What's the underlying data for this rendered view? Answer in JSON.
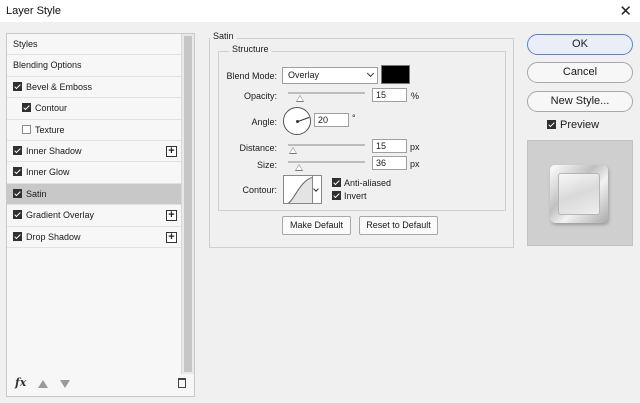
{
  "window": {
    "title": "Layer Style",
    "close_glyph": "✕"
  },
  "styles_panel": {
    "items": [
      {
        "label": "Styles",
        "checkbox": "none",
        "indent": false,
        "plus": false,
        "selected": false
      },
      {
        "label": "Blending Options",
        "checkbox": "none",
        "indent": false,
        "plus": false,
        "selected": false
      },
      {
        "label": "Bevel & Emboss",
        "checkbox": "on",
        "indent": false,
        "plus": false,
        "selected": false
      },
      {
        "label": "Contour",
        "checkbox": "on",
        "indent": true,
        "plus": false,
        "selected": false
      },
      {
        "label": "Texture",
        "checkbox": "off",
        "indent": true,
        "plus": false,
        "selected": false
      },
      {
        "label": "Inner Shadow",
        "checkbox": "on",
        "indent": false,
        "plus": true,
        "selected": false
      },
      {
        "label": "Inner Glow",
        "checkbox": "on",
        "indent": false,
        "plus": false,
        "selected": false
      },
      {
        "label": "Satin",
        "checkbox": "on",
        "indent": false,
        "plus": false,
        "selected": true
      },
      {
        "label": "Gradient Overlay",
        "checkbox": "on",
        "indent": false,
        "plus": true,
        "selected": false
      },
      {
        "label": "Drop Shadow",
        "checkbox": "on",
        "indent": false,
        "plus": true,
        "selected": false
      }
    ],
    "fx_label": "fx"
  },
  "satin": {
    "group_title": "Satin",
    "structure_title": "Structure",
    "blend_mode_label": "Blend Mode:",
    "blend_mode_value": "Overlay",
    "color": "#000000",
    "opacity_label": "Opacity:",
    "opacity_value": "15",
    "opacity_unit": "%",
    "opacity_level": 0.15,
    "angle_label": "Angle:",
    "angle_value": "20",
    "angle_unit": "°",
    "distance_label": "Distance:",
    "distance_value": "15",
    "distance_unit": "px",
    "distance_level": 0.06,
    "size_label": "Size:",
    "size_value": "36",
    "size_unit": "px",
    "size_level": 0.14,
    "contour_label": "Contour:",
    "anti_aliased_label": "Anti-aliased",
    "invert_label": "Invert",
    "make_default_label": "Make Default",
    "reset_default_label": "Reset to Default"
  },
  "actions": {
    "ok_label": "OK",
    "cancel_label": "Cancel",
    "new_style_label": "New Style...",
    "preview_label": "Preview"
  },
  "colors": {
    "selected_row": "#c8c8c8",
    "ok_border": "#5a82c8",
    "satin_color": "#000000"
  }
}
